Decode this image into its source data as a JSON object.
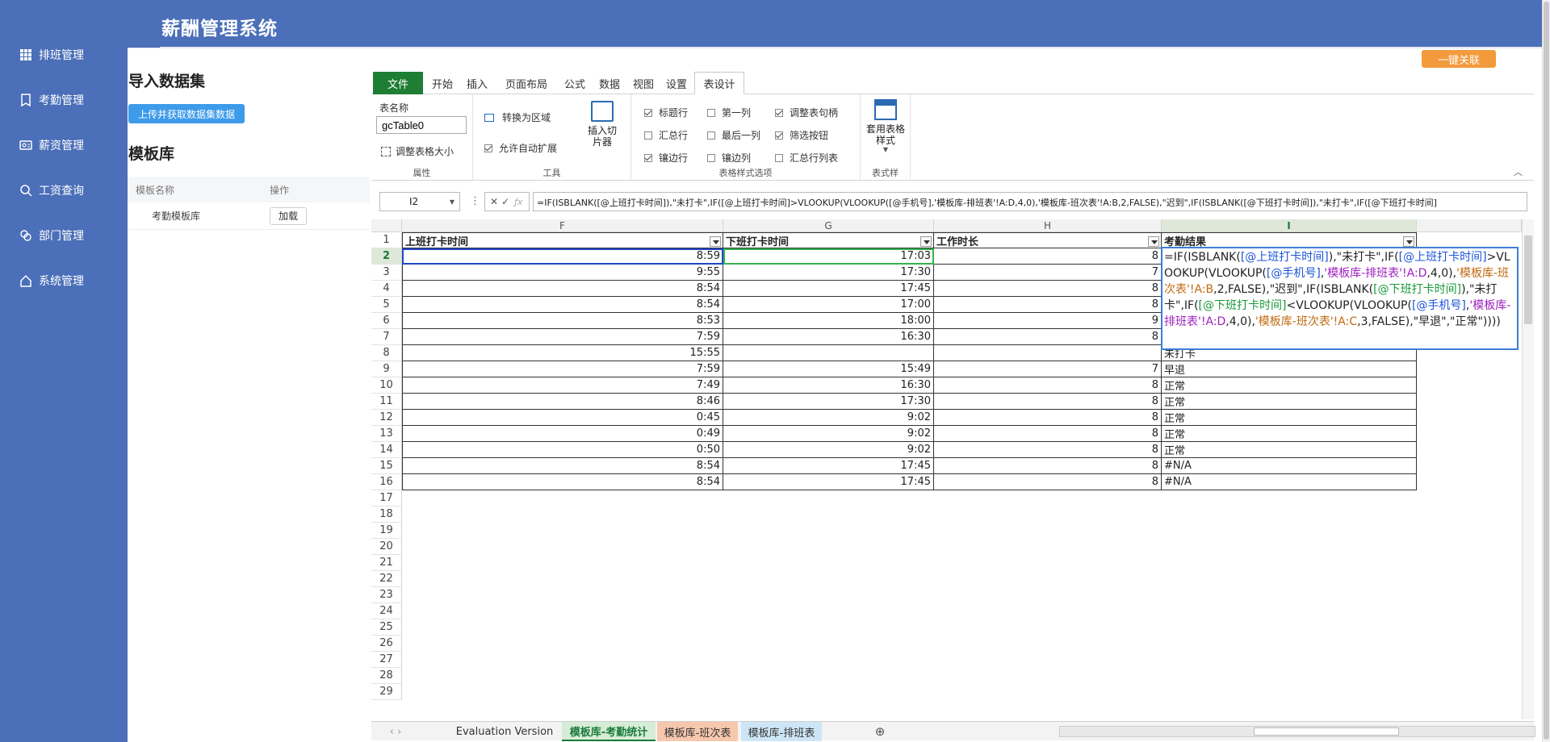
{
  "app": {
    "title": "薪酬管理系统"
  },
  "sidebar": {
    "items": [
      {
        "label": "排班管理",
        "icon": "grid-icon"
      },
      {
        "label": "考勤管理",
        "icon": "bookmark-icon"
      },
      {
        "label": "薪资管理",
        "icon": "id-card-icon"
      },
      {
        "label": "工资查询",
        "icon": "search-icon"
      },
      {
        "label": "部门管理",
        "icon": "link-icon"
      },
      {
        "label": "系统管理",
        "icon": "home-icon"
      }
    ]
  },
  "left_panel": {
    "import_title": "导入数据集",
    "upload_label": "上传并获取数据集数据",
    "template_title": "模板库",
    "table_headers": [
      "模板名称",
      "操作"
    ],
    "rows": [
      {
        "name": "考勤模板库",
        "action": "加载"
      }
    ]
  },
  "link_button": "一键关联",
  "ribbon": {
    "tabs": [
      "文件",
      "开始",
      "插入",
      "页面布局",
      "公式",
      "数据",
      "视图",
      "设置",
      "表设计"
    ],
    "active_tab": "表设计",
    "props": {
      "label": "表名称",
      "table_name": "gcTable0",
      "resize": "调整表格大小",
      "group": "属性"
    },
    "tools": {
      "convert": "转换为区域",
      "autoexpand": "允许自动扩展",
      "slicer": "插入切片器",
      "group": "工具"
    },
    "options": {
      "items": [
        {
          "label": "标题行",
          "checked": true
        },
        {
          "label": "第一列",
          "checked": false
        },
        {
          "label": "调整表句柄",
          "checked": true
        },
        {
          "label": "汇总行",
          "checked": false
        },
        {
          "label": "最后一列",
          "checked": false
        },
        {
          "label": "筛选按钮",
          "checked": true
        },
        {
          "label": "镶边行",
          "checked": true
        },
        {
          "label": "镶边列",
          "checked": false
        },
        {
          "label": "汇总行列表",
          "checked": false
        }
      ],
      "group": "表格样式选项"
    },
    "styles": {
      "label": "套用表格样式",
      "group": "表式样"
    }
  },
  "formula_bar": {
    "cell_ref": "I2",
    "formula": "=IF(ISBLANK([@上班打卡时间]),\"未打卡\",IF([@上班打卡时间]>VLOOKUP(VLOOKUP([@手机号],'模板库-排班表'!A:D,4,0),'模板库-班次表'!A:B,2,FALSE),\"迟到\",IF(ISBLANK([@下班打卡时间]),\"未打卡\",IF([@下班打卡时间]"
  },
  "grid": {
    "columns": [
      "F",
      "G",
      "H",
      "I"
    ],
    "headers": [
      "上班打卡时间",
      "下班打卡时间",
      "工作时长",
      "考勤结果"
    ],
    "rows": [
      {
        "n": "2",
        "F": "8:59",
        "G": "17:03",
        "H": "8",
        "I": ""
      },
      {
        "n": "3",
        "F": "9:55",
        "G": "17:30",
        "H": "7",
        "I": ""
      },
      {
        "n": "4",
        "F": "8:54",
        "G": "17:45",
        "H": "8",
        "I": ""
      },
      {
        "n": "5",
        "F": "8:54",
        "G": "17:00",
        "H": "8",
        "I": ""
      },
      {
        "n": "6",
        "F": "8:53",
        "G": "18:00",
        "H": "9",
        "I": ""
      },
      {
        "n": "7",
        "F": "7:59",
        "G": "16:30",
        "H": "8",
        "I": ""
      },
      {
        "n": "8",
        "F": "15:55",
        "G": "",
        "H": "",
        "I": "未打卡"
      },
      {
        "n": "9",
        "F": "7:59",
        "G": "15:49",
        "H": "7",
        "I": "早退"
      },
      {
        "n": "10",
        "F": "7:49",
        "G": "16:30",
        "H": "8",
        "I": "正常"
      },
      {
        "n": "11",
        "F": "8:46",
        "G": "17:30",
        "H": "8",
        "I": "正常"
      },
      {
        "n": "12",
        "F": "0:45",
        "G": "9:02",
        "H": "8",
        "I": "正常"
      },
      {
        "n": "13",
        "F": "0:49",
        "G": "9:02",
        "H": "8",
        "I": "正常"
      },
      {
        "n": "14",
        "F": "0:50",
        "G": "9:02",
        "H": "8",
        "I": "正常"
      },
      {
        "n": "15",
        "F": "8:54",
        "G": "17:45",
        "H": "8",
        "I": "#N/A"
      },
      {
        "n": "16",
        "F": "8:54",
        "G": "17:45",
        "H": "8",
        "I": "#N/A"
      }
    ],
    "empty_rows": [
      "17",
      "18",
      "19",
      "20",
      "21",
      "22",
      "23",
      "24",
      "25",
      "26",
      "27",
      "28",
      "29"
    ],
    "editor": {
      "p1": "=IF(ISBLANK(",
      "r1": "[@上班打卡时间]",
      "p2": "),\"未打卡\",IF(",
      "r2": "[@上班打卡时间]",
      "p3": ">VLOOKUP(VLOOKUP(",
      "r3": "[@手机号]",
      "p4": ",",
      "r4": "'模板库-排班表'!A:D",
      "p5": ",4,0),",
      "r5": "'模板库-班次表'!A:B",
      "p6": ",2,FALSE),\"迟到\",IF(ISBLANK(",
      "r6": "[@下班打卡时间]",
      "p7": "),\"未打卡\",IF(",
      "r7": "[@下班打卡时间]",
      "p8": "<VLOOKUP(VLOOKUP(",
      "r8": "[@手机号]",
      "p9": ",",
      "r9": "'模板库-排班表'!A:D",
      "p10": ",4,0),",
      "r10": "'模板库-班次表'!A:C",
      "p11": ",3,FALSE),\"早退\",\"正常\"))))"
    }
  },
  "sheets": {
    "tabs": [
      "Evaluation Version",
      "模板库-考勤统计",
      "模板库-班次表",
      "模板库-排班表"
    ],
    "active": "模板库-考勤统计",
    "colors": {
      "考勤统计": "#d6ecd6",
      "班次表": "#f7c7ad",
      "排班表": "#cde6f5"
    }
  }
}
